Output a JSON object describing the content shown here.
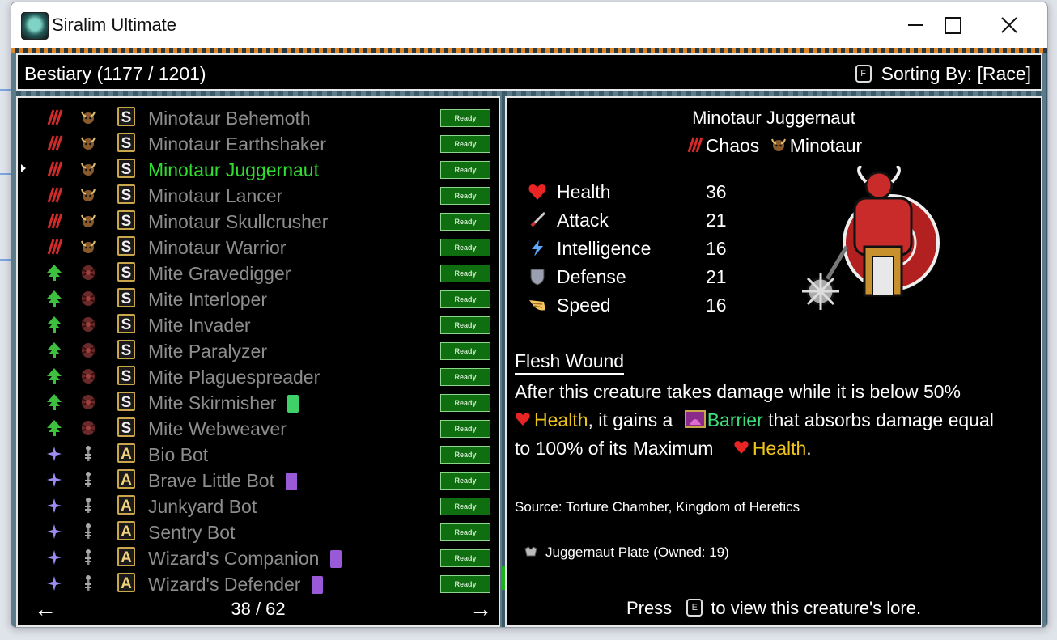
{
  "window": {
    "title": "Siralim Ultimate"
  },
  "header": {
    "title": "Bestiary (1177 / 1201)",
    "sort_key": "F",
    "sort_label": "Sorting By: [Race]"
  },
  "list": {
    "selected_index": 2,
    "ready_label": "Ready",
    "items": [
      {
        "name": "Minotaur Behemoth",
        "class": "S",
        "element": "chaos",
        "race": "minotaur"
      },
      {
        "name": "Minotaur Earthshaker",
        "class": "S",
        "element": "chaos",
        "race": "minotaur"
      },
      {
        "name": "Minotaur Juggernaut",
        "class": "S",
        "element": "chaos",
        "race": "minotaur"
      },
      {
        "name": "Minotaur Lancer",
        "class": "S",
        "element": "chaos",
        "race": "minotaur"
      },
      {
        "name": "Minotaur Skullcrusher",
        "class": "S",
        "element": "chaos",
        "race": "minotaur"
      },
      {
        "name": "Minotaur Warrior",
        "class": "S",
        "element": "chaos",
        "race": "minotaur"
      },
      {
        "name": "Mite Gravedigger",
        "class": "S",
        "element": "nature",
        "race": "mite"
      },
      {
        "name": "Mite Interloper",
        "class": "S",
        "element": "nature",
        "race": "mite"
      },
      {
        "name": "Mite Invader",
        "class": "S",
        "element": "nature",
        "race": "mite"
      },
      {
        "name": "Mite Paralyzer",
        "class": "S",
        "element": "nature",
        "race": "mite"
      },
      {
        "name": "Mite Plaguespreader",
        "class": "S",
        "element": "nature",
        "race": "mite"
      },
      {
        "name": "Mite Skirmisher",
        "class": "S",
        "element": "nature",
        "race": "mite",
        "tag": "green"
      },
      {
        "name": "Mite Webweaver",
        "class": "S",
        "element": "nature",
        "race": "mite"
      },
      {
        "name": "Bio Bot",
        "class": "A",
        "element": "sorcery",
        "race": "bot"
      },
      {
        "name": "Brave Little Bot",
        "class": "A",
        "element": "sorcery",
        "race": "bot",
        "tag": "purple"
      },
      {
        "name": "Junkyard Bot",
        "class": "A",
        "element": "sorcery",
        "race": "bot"
      },
      {
        "name": "Sentry Bot",
        "class": "A",
        "element": "sorcery",
        "race": "bot"
      },
      {
        "name": "Wizard's Companion",
        "class": "A",
        "element": "sorcery",
        "race": "bot",
        "tag": "purple"
      },
      {
        "name": "Wizard's Defender",
        "class": "A",
        "element": "sorcery",
        "race": "bot",
        "tag": "purple"
      }
    ]
  },
  "pager": {
    "prev": "←",
    "next": "→",
    "page": "38 / 62"
  },
  "detail": {
    "name": "Minotaur Juggernaut",
    "element": "Chaos",
    "race": "Minotaur",
    "stats": [
      {
        "label": "Health",
        "value": "36",
        "icon": "heart-icon"
      },
      {
        "label": "Attack",
        "value": "21",
        "icon": "sword-icon"
      },
      {
        "label": "Intelligence",
        "value": "16",
        "icon": "lightning-icon"
      },
      {
        "label": "Defense",
        "value": "21",
        "icon": "shield-icon"
      },
      {
        "label": "Speed",
        "value": "16",
        "icon": "wing-icon"
      }
    ],
    "ability_name": "Flesh Wound",
    "ability_text_1": "After this creature takes damage while it is below 50%",
    "ability_health_1": "Health",
    "ability_text_2": ", it gains a",
    "ability_barrier": "Barrier",
    "ability_text_3": " that absorbs damage equal",
    "ability_text_4": "to 100% of its Maximum",
    "ability_health_2": "Health",
    "ability_text_5": ".",
    "source": "Source: Torture Chamber, Kingdom of Heretics",
    "material": "Juggernaut Plate (Owned: 19)",
    "lore_press": "Press",
    "lore_key": "E",
    "lore_text": "to view this creature's lore."
  },
  "colors": {
    "chaos": "#d12a2a",
    "nature": "#3fbf3f",
    "sorcery": "#9b8cf0",
    "selected": "#2fdc2f",
    "ready_bg": "#0f6e0f",
    "highlight_yellow": "#f0c419",
    "highlight_green": "#3de07c"
  }
}
